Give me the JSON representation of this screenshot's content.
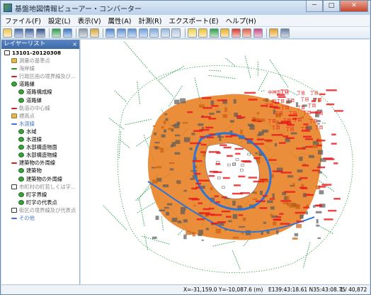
{
  "window": {
    "title": "基盤地図情報ビューアー・コンバーター",
    "minimize_label": "－",
    "maximize_label": "□",
    "close_label": "✕"
  },
  "menu": [
    {
      "label": "ファイル(F)"
    },
    {
      "label": "設定(L)"
    },
    {
      "label": "表示(V)"
    },
    {
      "label": "属性(A)"
    },
    {
      "label": "計測(R)"
    },
    {
      "label": "エクスポート(E)"
    },
    {
      "label": "ヘルプ(H)"
    }
  ],
  "toolbar": {
    "buttons": [
      {
        "icon": "open-folder-icon",
        "color": "#f1c64a"
      },
      {
        "icon": "save-icon",
        "color": "#4868a8"
      },
      {
        "icon": "save-as-icon",
        "color": "#3e5e9b"
      },
      {
        "icon": "disk-icon",
        "color": "#2f4f86"
      },
      {
        "sep": true
      },
      {
        "icon": "layer-green-icon",
        "color": "#2e9e48"
      },
      {
        "icon": "layer-blue-icon",
        "color": "#3a76c6"
      },
      {
        "sep": true
      },
      {
        "icon": "print-icon",
        "color": "#8a96a8"
      },
      {
        "icon": "copy-icon",
        "color": "#d8a63c"
      },
      {
        "sep": true
      },
      {
        "icon": "rectangle-icon",
        "color": "#4a82d0"
      },
      {
        "icon": "zoom-in-icon",
        "color": "#5c8fd4"
      },
      {
        "icon": "zoom-out-icon",
        "color": "#5c8fd4"
      },
      {
        "icon": "zoom-fit-icon",
        "color": "#6ea0de"
      },
      {
        "icon": "pan-icon",
        "color": "#80a8dc"
      },
      {
        "icon": "select-icon",
        "color": "#9ab8dc"
      },
      {
        "icon": "measure-icon",
        "color": "#b0c4dc"
      },
      {
        "sep": true
      },
      {
        "icon": "label-icon",
        "color": "#f2d24a"
      },
      {
        "icon": "chart-icon",
        "color": "#f0c030"
      },
      {
        "icon": "edit-icon",
        "color": "#2e9e48"
      },
      {
        "icon": "flag-icon",
        "color": "#e8b020"
      },
      {
        "icon": "flag-red-icon",
        "color": "#d83a2a"
      },
      {
        "icon": "export-icon",
        "color": "#e06040"
      },
      {
        "icon": "grid-icon",
        "color": "#c84a8a"
      },
      {
        "sep": true
      },
      {
        "icon": "help-icon",
        "color": "#e8a020"
      },
      {
        "icon": "about-icon",
        "color": "#6a7fa0"
      }
    ]
  },
  "sidebar": {
    "title": "レイヤーリスト",
    "close_label": "×",
    "items": [
      {
        "label": "13101-20120308",
        "indent": 0,
        "icon": "box",
        "style": "bold"
      },
      {
        "label": "測量の基準点",
        "indent": 1,
        "icon": "folder",
        "style": "dim"
      },
      {
        "label": "海岸線",
        "indent": 1,
        "icon": "line-green",
        "style": "dim"
      },
      {
        "label": "行政区画の境界線及び...",
        "indent": 1,
        "icon": "line-red",
        "style": "dim"
      },
      {
        "label": "道路縁",
        "indent": 1,
        "icon": "check",
        "style": "normal"
      },
      {
        "label": "道路構成線",
        "indent": 2,
        "icon": "check",
        "style": "normal"
      },
      {
        "label": "道路縁",
        "indent": 2,
        "icon": "check",
        "style": "normal"
      },
      {
        "label": "軌道の中心線",
        "indent": 1,
        "icon": "line-red",
        "style": "dim"
      },
      {
        "label": "標高点",
        "indent": 1,
        "icon": "folder",
        "style": "dim"
      },
      {
        "label": "水涯線",
        "indent": 1,
        "icon": "line-blue",
        "style": "blue"
      },
      {
        "label": "水域",
        "indent": 2,
        "icon": "check",
        "style": "normal"
      },
      {
        "label": "水涯線",
        "indent": 2,
        "icon": "check",
        "style": "normal"
      },
      {
        "label": "水部構造物面",
        "indent": 2,
        "icon": "check",
        "style": "normal"
      },
      {
        "label": "水部構造物線",
        "indent": 2,
        "icon": "check",
        "style": "normal"
      },
      {
        "label": "建築物の外周線",
        "indent": 1,
        "icon": "line-red",
        "style": "normal"
      },
      {
        "label": "建築物",
        "indent": 2,
        "icon": "check",
        "style": "normal"
      },
      {
        "label": "建築物の外周線",
        "indent": 2,
        "icon": "check",
        "style": "normal"
      },
      {
        "label": "市町村の町若しくは字...",
        "indent": 1,
        "icon": "box",
        "style": "dim"
      },
      {
        "label": "町字界線",
        "indent": 2,
        "icon": "check",
        "style": "normal"
      },
      {
        "label": "町字の代表点",
        "indent": 2,
        "icon": "check",
        "style": "normal"
      },
      {
        "label": "街区の境界線及び代表点",
        "indent": 1,
        "icon": "box",
        "style": "dim"
      },
      {
        "label": "その他",
        "indent": 1,
        "icon": "line-blue",
        "style": "blue"
      }
    ]
  },
  "map": {
    "colors": {
      "road": "#2aa24a",
      "town_label": "#e8181a",
      "building": "#e87a1a",
      "block": "#5a5a5a",
      "water": "#2b74d8",
      "palace": "#ffffff"
    },
    "town_labels": [
      "中神田丁目",
      "丁目",
      "丁目",
      "丁目",
      "四丁目",
      "丁目",
      "丁目",
      "丁目",
      "丁目",
      "丁目",
      "丁目",
      "丁目",
      "丁目",
      "丁目",
      "丁目",
      "丁目",
      "丁目",
      "丁目",
      "丁目",
      "丁目",
      "丁目",
      "丁目",
      "丁目",
      "丁目"
    ]
  },
  "status": {
    "coords": "X=-31,159.0 Y=-10,087.6 (m)",
    "latlon": "E139:43:18.61 N35:43:08.75",
    "scale": "1 / 40,872"
  }
}
